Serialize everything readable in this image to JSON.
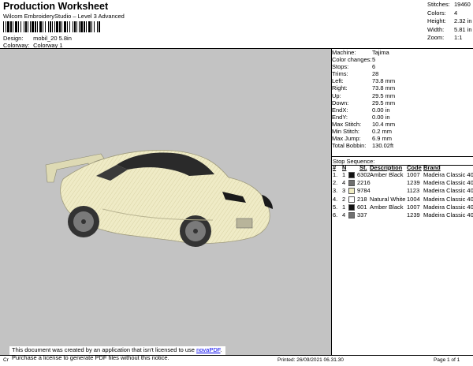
{
  "header": {
    "title": "Production Worksheet",
    "subtitle": "Wilcom EmbroideryStudio – Level 3 Advanced",
    "design_label": "Design:",
    "design_value": "mobil_20 5.8in",
    "colorway_label": "Colorway:",
    "colorway_value": "Colorway 1"
  },
  "summary": [
    {
      "label": "Stitches:",
      "value": "19460"
    },
    {
      "label": "Colors:",
      "value": "4"
    },
    {
      "label": "Height:",
      "value": "2.32 in"
    },
    {
      "label": "Width:",
      "value": "5.81 in"
    },
    {
      "label": "Zoom:",
      "value": "1:1"
    }
  ],
  "machine_info": [
    {
      "label": "Machine:",
      "value": "Tajima"
    },
    {
      "label": "Color changes:",
      "value": "5"
    },
    {
      "label": "Stops:",
      "value": "6"
    },
    {
      "label": "Trims:",
      "value": "28"
    },
    {
      "label": "Left:",
      "value": "73.8 mm"
    },
    {
      "label": "Right:",
      "value": "73.8 mm"
    },
    {
      "label": "Up:",
      "value": "29.5 mm"
    },
    {
      "label": "Down:",
      "value": "29.5 mm"
    },
    {
      "label": "EndX:",
      "value": "0.00 in"
    },
    {
      "label": "EndY:",
      "value": "0.00 in"
    },
    {
      "label": "Max Stitch:",
      "value": "10.4 mm"
    },
    {
      "label": "Min Stitch:",
      "value": "0.2 mm"
    },
    {
      "label": "Max Jump:",
      "value": "6.9 mm"
    },
    {
      "label": "Total Bobbin:",
      "value": "130.02ft"
    }
  ],
  "stop_sequence": {
    "title": "Stop Sequence:",
    "headers": [
      "#",
      "N",
      "St.",
      "Description",
      "Code",
      "Brand"
    ],
    "rows": [
      {
        "num": "1.",
        "n": "1",
        "swatch": "#111111",
        "st": "6302",
        "desc": "Amber Black",
        "code": "1007",
        "brand": "Madeira Classic 40"
      },
      {
        "num": "2.",
        "n": "4",
        "swatch": "#707070",
        "st": "2216",
        "desc": "",
        "code": "1239",
        "brand": "Madeira Classic 40"
      },
      {
        "num": "3.",
        "n": "3",
        "swatch": "#f0ecc2",
        "st": "9784",
        "desc": "",
        "code": "1123",
        "brand": "Madeira Classic 40"
      },
      {
        "num": "4.",
        "n": "2",
        "swatch": "#ffffff",
        "st": "218",
        "desc": "Natural White",
        "code": "1004",
        "brand": "Madeira Classic 40"
      },
      {
        "num": "5.",
        "n": "1",
        "swatch": "#111111",
        "st": "601",
        "desc": "Amber Black",
        "code": "1007",
        "brand": "Madeira Classic 40"
      },
      {
        "num": "6.",
        "n": "4",
        "swatch": "#707070",
        "st": "337",
        "desc": "",
        "code": "1239",
        "brand": "Madeira Classic 40"
      }
    ]
  },
  "notice": {
    "line1_pre": "This document was created by an application that isn't licensed to use ",
    "line1_link": "novaPDF",
    "line1_post": ".",
    "line2": "Purchase a license to generate PDF files without this notice."
  },
  "footer": {
    "left": "Cr",
    "printed": "Printed: 26/09/2021 06.31.30",
    "page": "Page 1 of 1"
  }
}
